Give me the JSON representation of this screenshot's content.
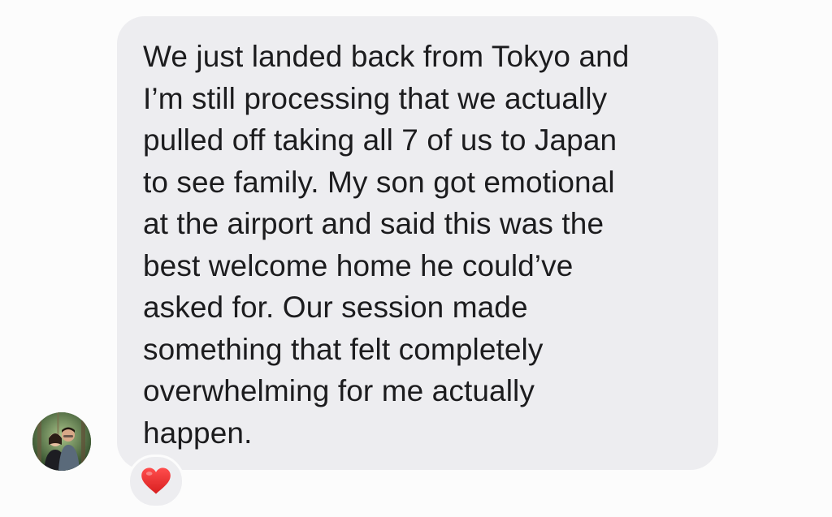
{
  "message": {
    "text": "We just landed back from Tokyo and\nI’m still processing that we actually\npulled off taking all 7 of us to Japan\nto see family. My son got emotional\nat the airport and said this was the\nbest welcome home he could’ve\nasked for. Our session made\nsomething that felt completely\noverwhelming for me actually\nhappen.",
    "reaction": "heart",
    "reaction_color": "#e02a2a"
  },
  "colors": {
    "bubble": "#ededf0",
    "text": "#1c1c1e",
    "background": "#fcfcfc"
  },
  "icons": {
    "avatar": "profile-photo",
    "reaction": "heart-icon"
  }
}
